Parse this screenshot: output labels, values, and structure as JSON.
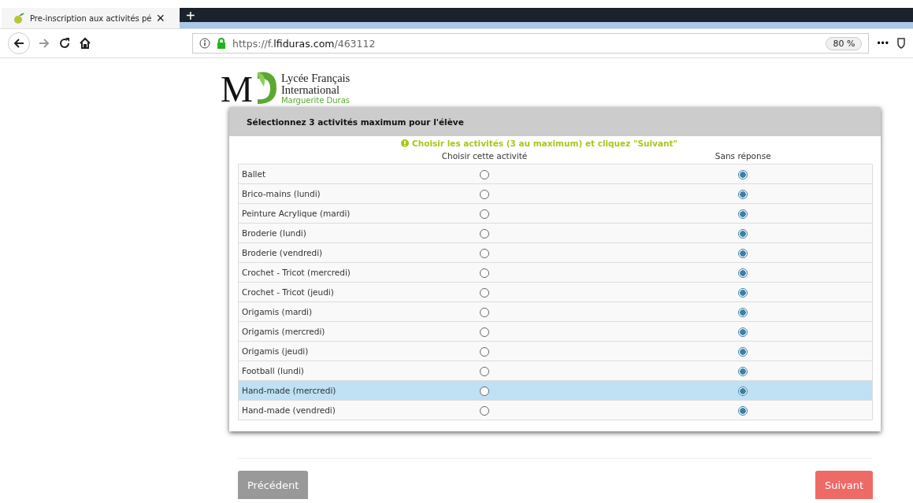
{
  "browser": {
    "tab_title": "Pre-inscription aux activités pé",
    "tab_close": "×",
    "new_tab": "+",
    "url_prefix": "https://f.",
    "url_domain": "lfiduras.com",
    "url_path": "/463112",
    "zoom": "80 %",
    "more": "•••"
  },
  "logo": {
    "letters": "M",
    "line1": "Lycée Français",
    "line2": "International",
    "line3": "Marguerite Duras"
  },
  "card": {
    "title": "Sélectionnez 3 activités maximum pour l'élève",
    "hint": "Choisir les activités (3 au maximum) et cliquez \"Suivant\"",
    "columns": [
      "Choisir cette activité",
      "Sans réponse"
    ],
    "rows": [
      {
        "label": "Ballet",
        "highlighted": false,
        "choices": [
          {
            "selected": false
          },
          {
            "selected": true
          }
        ]
      },
      {
        "label": "Brico-mains (lundi)",
        "highlighted": false,
        "choices": [
          {
            "selected": false
          },
          {
            "selected": true
          }
        ]
      },
      {
        "label": "Peinture Acrylique (mardi)",
        "highlighted": false,
        "choices": [
          {
            "selected": false
          },
          {
            "selected": true
          }
        ]
      },
      {
        "label": "Broderie (lundi)",
        "highlighted": false,
        "choices": [
          {
            "selected": false
          },
          {
            "selected": true
          }
        ]
      },
      {
        "label": "Broderie (vendredi)",
        "highlighted": false,
        "choices": [
          {
            "selected": false
          },
          {
            "selected": true
          }
        ]
      },
      {
        "label": "Crochet - Tricot (mercredi)",
        "highlighted": false,
        "choices": [
          {
            "selected": false
          },
          {
            "selected": true
          }
        ]
      },
      {
        "label": "Crochet - Tricot (jeudi)",
        "highlighted": false,
        "choices": [
          {
            "selected": false
          },
          {
            "selected": true
          }
        ]
      },
      {
        "label": "Origamis (mardi)",
        "highlighted": false,
        "choices": [
          {
            "selected": false
          },
          {
            "selected": true
          }
        ]
      },
      {
        "label": "Origamis (mercredi)",
        "highlighted": false,
        "choices": [
          {
            "selected": false
          },
          {
            "selected": true
          }
        ]
      },
      {
        "label": "Origamis (jeudi)",
        "highlighted": false,
        "choices": [
          {
            "selected": false
          },
          {
            "selected": true
          }
        ]
      },
      {
        "label": "Football (lundi)",
        "highlighted": false,
        "choices": [
          {
            "selected": false
          },
          {
            "selected": true
          }
        ]
      },
      {
        "label": "Hand-made (mercredi)",
        "highlighted": true,
        "choices": [
          {
            "selected": false
          },
          {
            "selected": true
          }
        ]
      },
      {
        "label": "Hand-made (vendredi)",
        "highlighted": false,
        "choices": [
          {
            "selected": false
          },
          {
            "selected": true
          }
        ]
      }
    ]
  },
  "buttons": [
    {
      "label": "Précédent",
      "kind": "secondary"
    },
    {
      "label": "Suivant",
      "kind": "primary"
    }
  ]
}
